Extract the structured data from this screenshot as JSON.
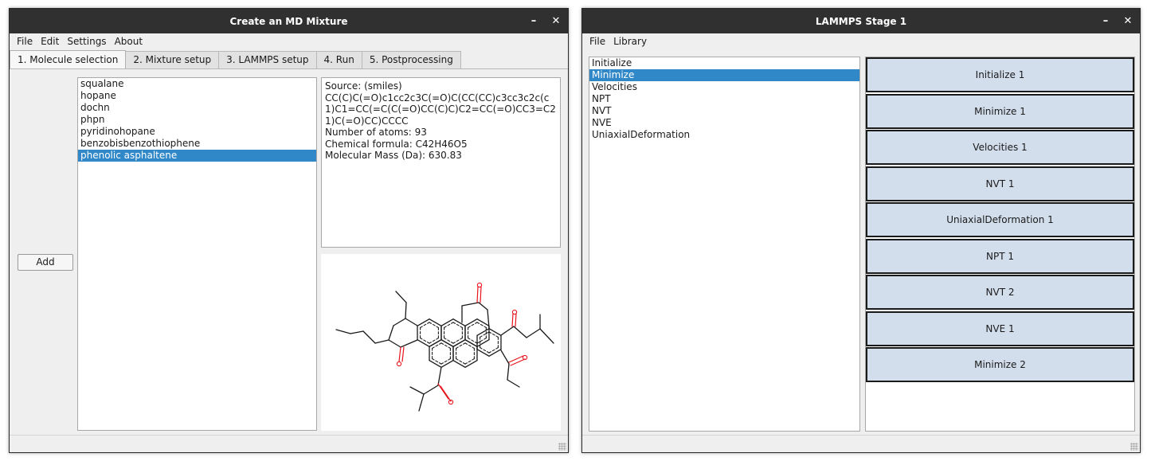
{
  "left_window": {
    "title": "Create an MD Mixture",
    "controls": {
      "minimize": "–",
      "close": "✕"
    },
    "menu": [
      "File",
      "Edit",
      "Settings",
      "About"
    ],
    "tabs": [
      "1. Molecule selection",
      "2. Mixture setup",
      "3. LAMMPS setup",
      "4. Run",
      "5. Postprocessing"
    ],
    "add_button": "Add",
    "molecules": [
      "squalane",
      "hopane",
      "dochn",
      "phpn",
      "pyridinohopane",
      "benzobisbenzothiophene",
      "phenolic asphaltene"
    ],
    "selected_molecule": "phenolic asphaltene",
    "info": {
      "source": "Source: (smiles)",
      "smiles": "CC(C)C(=O)c1cc2c3C(=O)C(CC(CC)c3cc3c2c(c1)C1=CC(=C(C(=O)CC(C)C)C2=CC(=O)CC3=C21)C(=O)CC)CCCC",
      "atoms": "Number of atoms: 93",
      "formula": "Chemical formula: C42H46O5",
      "mass": "Molecular Mass (Da):  630.83"
    },
    "colors": {
      "bond": "#1a1a1a",
      "oxygen": "#e8141c"
    }
  },
  "right_window": {
    "title": "LAMMPS Stage 1",
    "controls": {
      "minimize": "–",
      "close": "✕"
    },
    "menu": [
      "File",
      "Library"
    ],
    "stage_types": [
      "Initialize",
      "Minimize",
      "Velocities",
      "NPT",
      "NVT",
      "NVE",
      "UniaxialDeformation"
    ],
    "selected_stage_type": "Minimize",
    "stages": [
      "Initialize 1",
      "Minimize 1",
      "Velocities 1",
      "NVT 1",
      "UniaxialDeformation 1",
      "NPT 1",
      "NVT 2",
      "NVE 1",
      "Minimize 2"
    ],
    "colors": {
      "stage_fill": "#d3deed",
      "selection": "#3088c8"
    }
  }
}
